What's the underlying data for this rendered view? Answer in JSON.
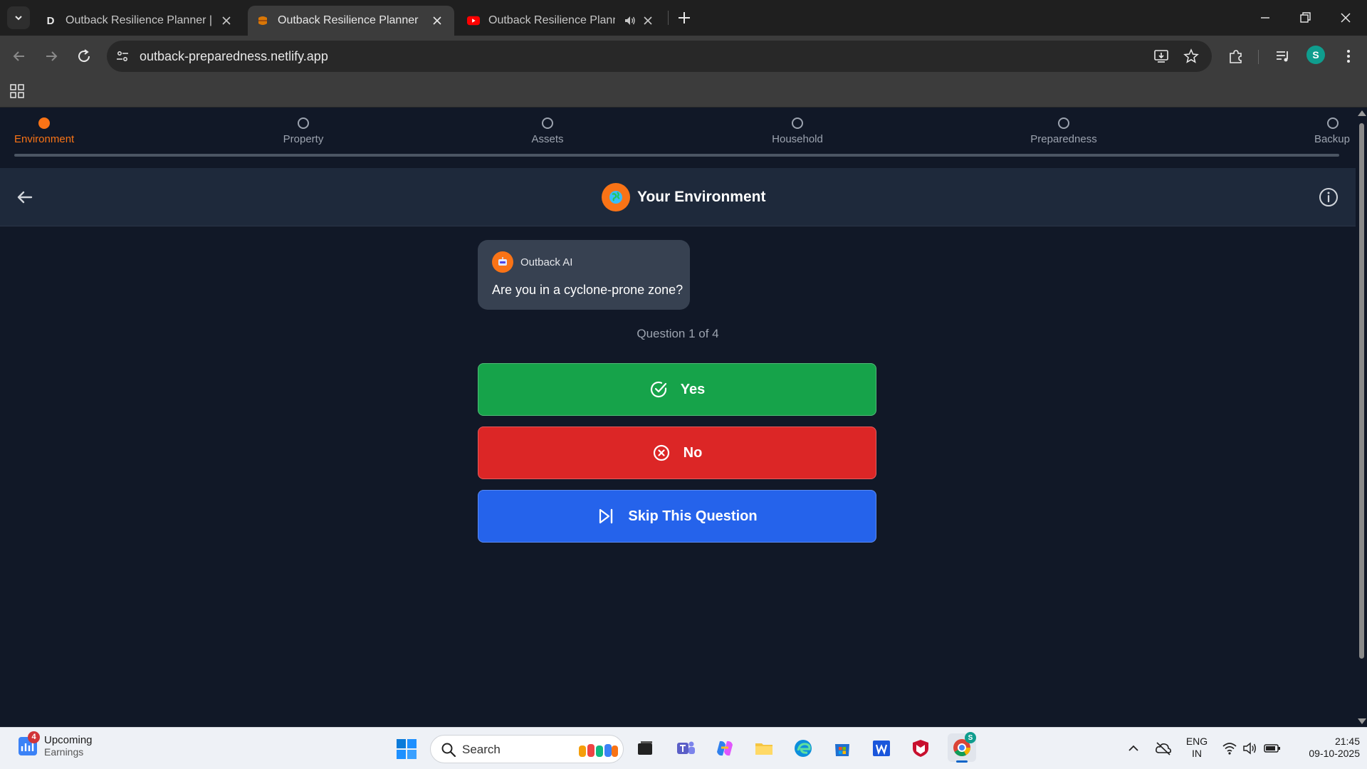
{
  "browser": {
    "tabs": [
      {
        "title": "Outback Resilience Planner | De",
        "favicon_letter": "D",
        "active": false
      },
      {
        "title": "Outback Resilience Planner",
        "active": true
      },
      {
        "title": "Outback Resilience Planner",
        "active": false,
        "audio": true
      }
    ],
    "url": "outback-preparedness.netlify.app",
    "profile_initial": "S",
    "accent": "#0f9d8e"
  },
  "app": {
    "steps": [
      {
        "label": "Environment",
        "active": true
      },
      {
        "label": "Property",
        "active": false
      },
      {
        "label": "Assets",
        "active": false
      },
      {
        "label": "Household",
        "active": false
      },
      {
        "label": "Preparedness",
        "active": false
      },
      {
        "label": "Backup",
        "active": false
      }
    ],
    "header_title": "Your Environment",
    "assistant_name": "Outback AI",
    "question": "Are you in a cyclone-prone zone?",
    "counter": "Question 1 of 4",
    "buttons": {
      "yes": "Yes",
      "no": "No",
      "skip": "Skip This Question"
    },
    "colors": {
      "accent": "#f97316",
      "yes": "#16a34a",
      "no": "#dc2626",
      "skip": "#2563eb",
      "background": "#111827"
    }
  },
  "taskbar": {
    "widget_title": "Upcoming",
    "widget_subtitle": "Earnings",
    "widget_badge": "4",
    "search_placeholder": "Search",
    "lang_line1": "ENG",
    "lang_line2": "IN",
    "time": "21:45",
    "date": "09-10-2025",
    "chrome_badge": "S"
  }
}
